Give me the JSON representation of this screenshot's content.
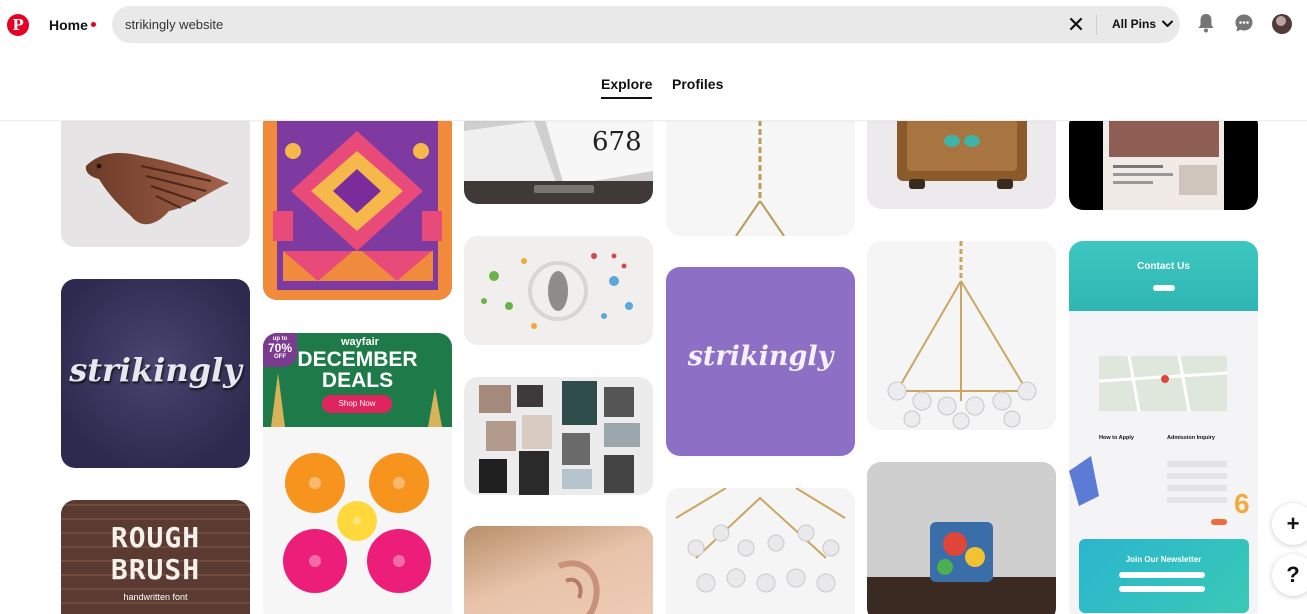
{
  "brand": {
    "logo_glyph": "P",
    "accent": "#e60023"
  },
  "header": {
    "home_label": "Home",
    "search_value": "strikingly website",
    "scope_label": "All Pins"
  },
  "tabs": [
    {
      "label": "Explore"
    },
    {
      "label": "Profiles"
    }
  ],
  "pins": {
    "strikingly_1": "strikingly",
    "strikingly_2": "strikingly",
    "wayfair_brand": "wayfair",
    "wayfair_badge_top": "up to",
    "wayfair_badge_pct": "70%",
    "wayfair_badge_bottom": "OFF",
    "wayfair_title_1": "DECEMBER",
    "wayfair_title_2": "DEALS",
    "wayfair_cta": "Shop Now",
    "rough_1": "ROUGH",
    "rough_2": "BRUSH",
    "rough_sub": "handwritten font",
    "contact_title": "Contact Us",
    "how_to_apply": "How to Apply",
    "admission": "Admission Inquiry",
    "newsletter": "Join Our Newsletter",
    "numbers": "678"
  },
  "floating": {
    "add": "+",
    "help": "?"
  },
  "icons": [
    "pinterest-logo-icon",
    "clear-search-icon",
    "chevron-down-icon",
    "bell-icon",
    "chat-icon",
    "avatar"
  ]
}
